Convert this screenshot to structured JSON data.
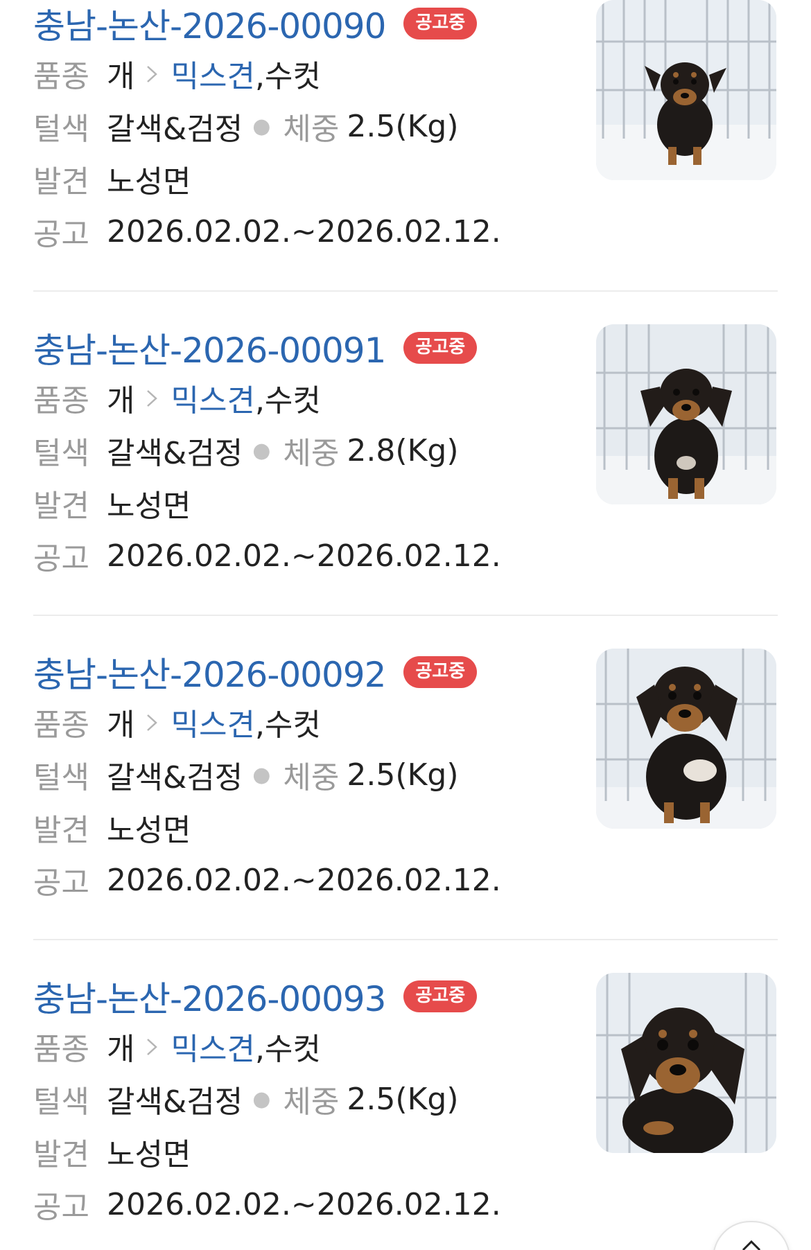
{
  "labels": {
    "breed": "품종",
    "color": "털색",
    "weight": "체중",
    "found": "발견",
    "notice": "공고"
  },
  "status_badge": "공고중",
  "colors": {
    "link_blue": "#2b66b0",
    "badge_red": "#e64b4b",
    "label_gray": "#9a9a9a"
  },
  "listings": [
    {
      "id": "충남-논산-2026-00090",
      "status": "공고중",
      "species": "개",
      "breed": "믹스견",
      "sex": ",수컷",
      "color": "갈색&검정",
      "weight": "2.5(Kg)",
      "found_location": "노성면",
      "notice_period": "2026.02.02.~2026.02.12.",
      "photo": "puppy-photo"
    },
    {
      "id": "충남-논산-2026-00091",
      "status": "공고중",
      "species": "개",
      "breed": "믹스견",
      "sex": ",수컷",
      "color": "갈색&검정",
      "weight": "2.8(Kg)",
      "found_location": "노성면",
      "notice_period": "2026.02.02.~2026.02.12.",
      "photo": "puppy-photo"
    },
    {
      "id": "충남-논산-2026-00092",
      "status": "공고중",
      "species": "개",
      "breed": "믹스견",
      "sex": ",수컷",
      "color": "갈색&검정",
      "weight": "2.5(Kg)",
      "found_location": "노성면",
      "notice_period": "2026.02.02.~2026.02.12.",
      "photo": "puppy-photo"
    },
    {
      "id": "충남-논산-2026-00093",
      "status": "공고중",
      "species": "개",
      "breed": "믹스견",
      "sex": ",수컷",
      "color": "갈색&검정",
      "weight": "2.5(Kg)",
      "found_location": "노성면",
      "notice_period": "2026.02.02.~2026.02.12.",
      "photo": "puppy-photo"
    }
  ],
  "scroll_top_icon": "chevron-up-icon"
}
